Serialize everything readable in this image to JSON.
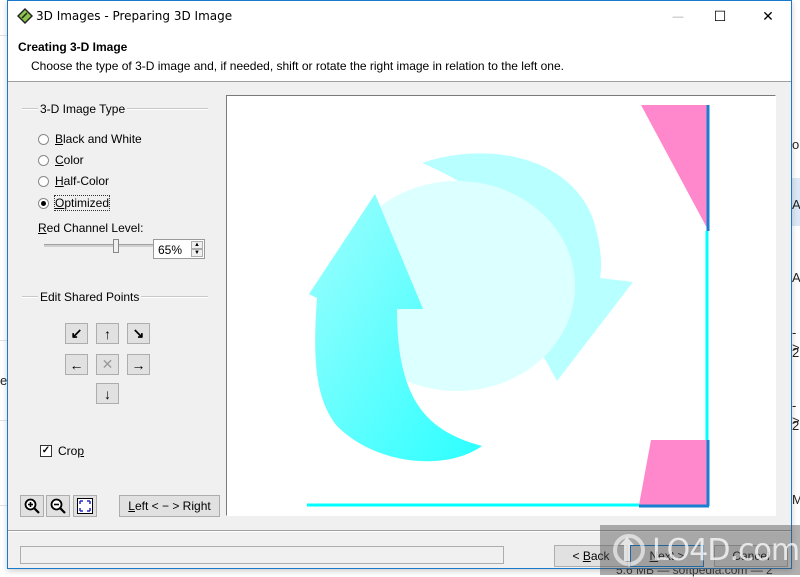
{
  "window": {
    "title": "3D Images - Preparing 3D Image",
    "minimize_label": "—",
    "maximize_label": "☐",
    "close_label": "✕"
  },
  "header": {
    "title": "Creating 3-D Image",
    "description": "Choose the type of 3-D image and, if needed, shift or rotate the right image in relation to the left one."
  },
  "image_type": {
    "group_label": "3-D Image Type",
    "options": [
      {
        "label_u": "B",
        "label_rest": "lack and White",
        "checked": false
      },
      {
        "label_u": "C",
        "label_rest": "olor",
        "checked": false
      },
      {
        "label_u": "H",
        "label_rest": "alf-Color",
        "checked": false
      },
      {
        "label_u": "O",
        "label_rest": "ptimized",
        "checked": true
      }
    ],
    "selected": "Optimized"
  },
  "red_channel": {
    "label_u": "R",
    "label_rest": "ed Channel Level:",
    "value_text": "65%",
    "value_percent": 65,
    "spin_up": "▲",
    "spin_down": "▼"
  },
  "shared_points": {
    "group_label": "Edit Shared Points",
    "buttons": {
      "rotate_left": "↙",
      "up": "↑",
      "rotate_right": "↘",
      "left": "←",
      "reset": "✕",
      "right": "→",
      "down": "↓"
    }
  },
  "crop": {
    "label_main": "Cro",
    "label_u": "p",
    "checked": true,
    "check_glyph": "✓"
  },
  "toolbar": {
    "zoom_in_icon": "zoom-in",
    "zoom_out_icon": "zoom-out",
    "fit_icon": "fit-to-window",
    "swap_u": "L",
    "swap_rest": "eft < − > Right"
  },
  "footer": {
    "status_text": "",
    "back_prefix": "< ",
    "back_u": "B",
    "back_rest": "ack",
    "next_u": "N",
    "next_rest": "ext >",
    "cancel": "Cancel"
  },
  "background": {
    "left_text": "e",
    "right_texts": [
      "o",
      "A",
      "A",
      "->",
      "2",
      "->",
      "2",
      "M"
    ],
    "bottom_text": "5.6 MB — softpedia.com — 2"
  },
  "watermark": {
    "text": "LO4D.com"
  },
  "colors": {
    "accent": "#1979ca",
    "cyan": "#00ffff",
    "pink": "#ff88cc",
    "dialog_bg": "#f0f0f0"
  }
}
